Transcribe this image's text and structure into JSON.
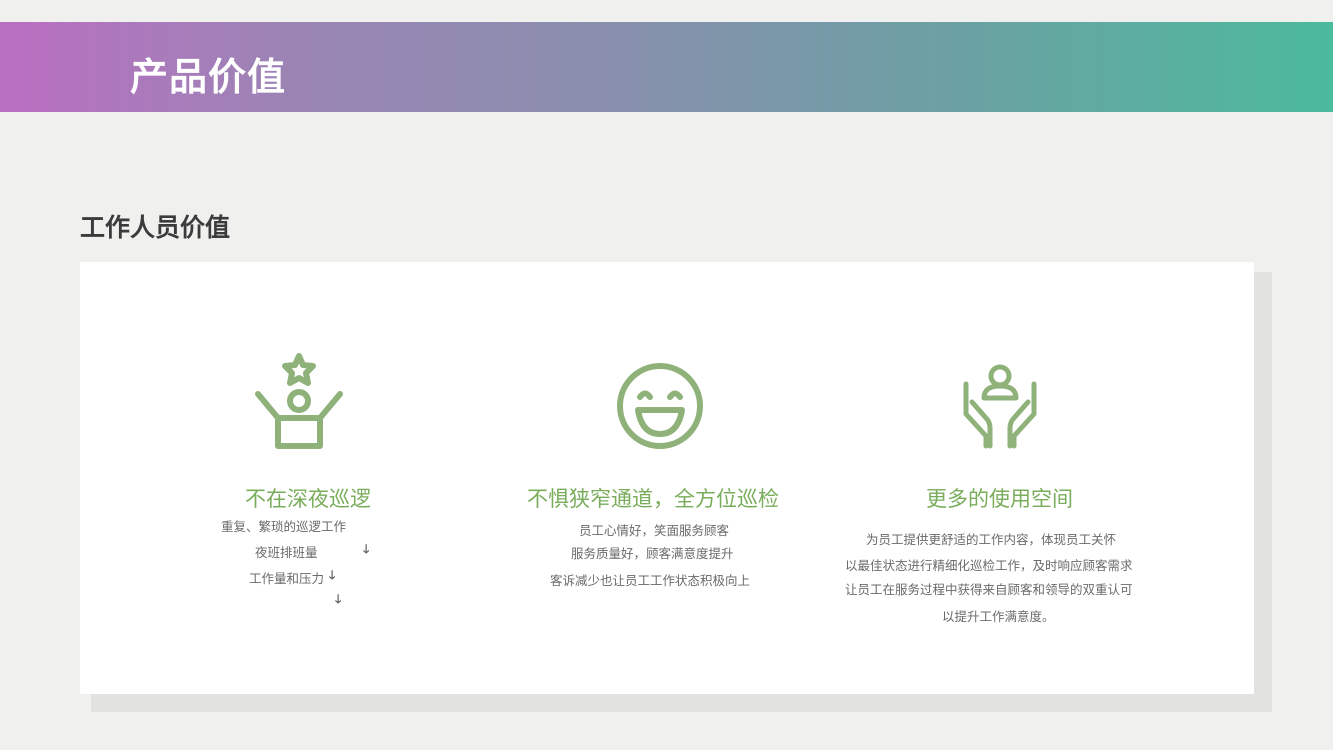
{
  "header": {
    "title": "产品价值"
  },
  "section": {
    "title": "工作人员价值"
  },
  "columns": [
    {
      "icon": "cheering-person-star-icon",
      "title": "不在深夜巡逻",
      "lines": [
        "重复、繁琐的巡逻工作",
        "夜班排班量",
        "工作量和压力"
      ],
      "arrow_glyph": "🡓"
    },
    {
      "icon": "smiling-face-icon",
      "title": "不惧狭窄通道，全方位巡检",
      "lines": [
        "员工心情好，笑面服务顾客",
        "服务质量好，顾客满意度提升",
        "客诉减少也让员工工作状态积极向上"
      ]
    },
    {
      "icon": "hands-holding-person-icon",
      "title": "更多的使用空间",
      "lines": [
        "为员工提供更舒适的工作内容，体现员工关怀",
        "以最佳状态进行精细化巡检工作，及时响应顾客需求",
        "让员工在服务过程中获得来自顾客和领导的双重认可",
        "以提升工作满意度。"
      ]
    }
  ],
  "colors": {
    "accent": "#79ad5b",
    "icon": "#8fb27a"
  }
}
